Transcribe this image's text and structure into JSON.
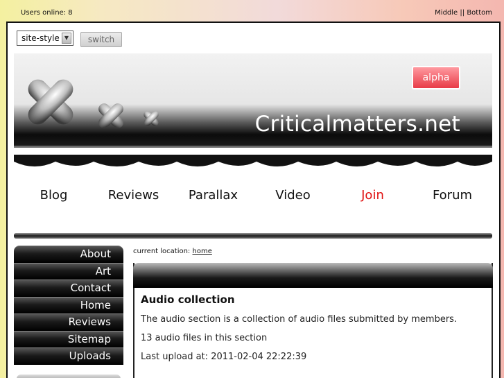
{
  "topbar": {
    "users_online": "Users online: 8",
    "link_middle": "Middle",
    "separator": " || ",
    "link_bottom": "Bottom"
  },
  "style_switcher": {
    "selected": "site-style",
    "switch_label": "switch"
  },
  "banner": {
    "site_title": "Criticalmatters.net",
    "badge": "alpha"
  },
  "nav": {
    "items": [
      {
        "label": "Blog"
      },
      {
        "label": "Reviews"
      },
      {
        "label": "Parallax"
      },
      {
        "label": "Video"
      },
      {
        "label": "Join"
      },
      {
        "label": "Forum"
      }
    ],
    "active_color": "#e01010"
  },
  "sidebar": {
    "items": [
      {
        "label": "About"
      },
      {
        "label": "Art"
      },
      {
        "label": "Contact"
      },
      {
        "label": "Home"
      },
      {
        "label": "Reviews"
      },
      {
        "label": "Sitemap"
      },
      {
        "label": "Uploads"
      }
    ]
  },
  "location": {
    "prefix": "current location:",
    "link": "home"
  },
  "content": {
    "title": "Audio collection",
    "description": "The audio section is a collection of audio files submitted by members.",
    "count_text": "13 audio files in this section",
    "last_upload": "Last upload at: 2011-02-04 22:22:39"
  }
}
